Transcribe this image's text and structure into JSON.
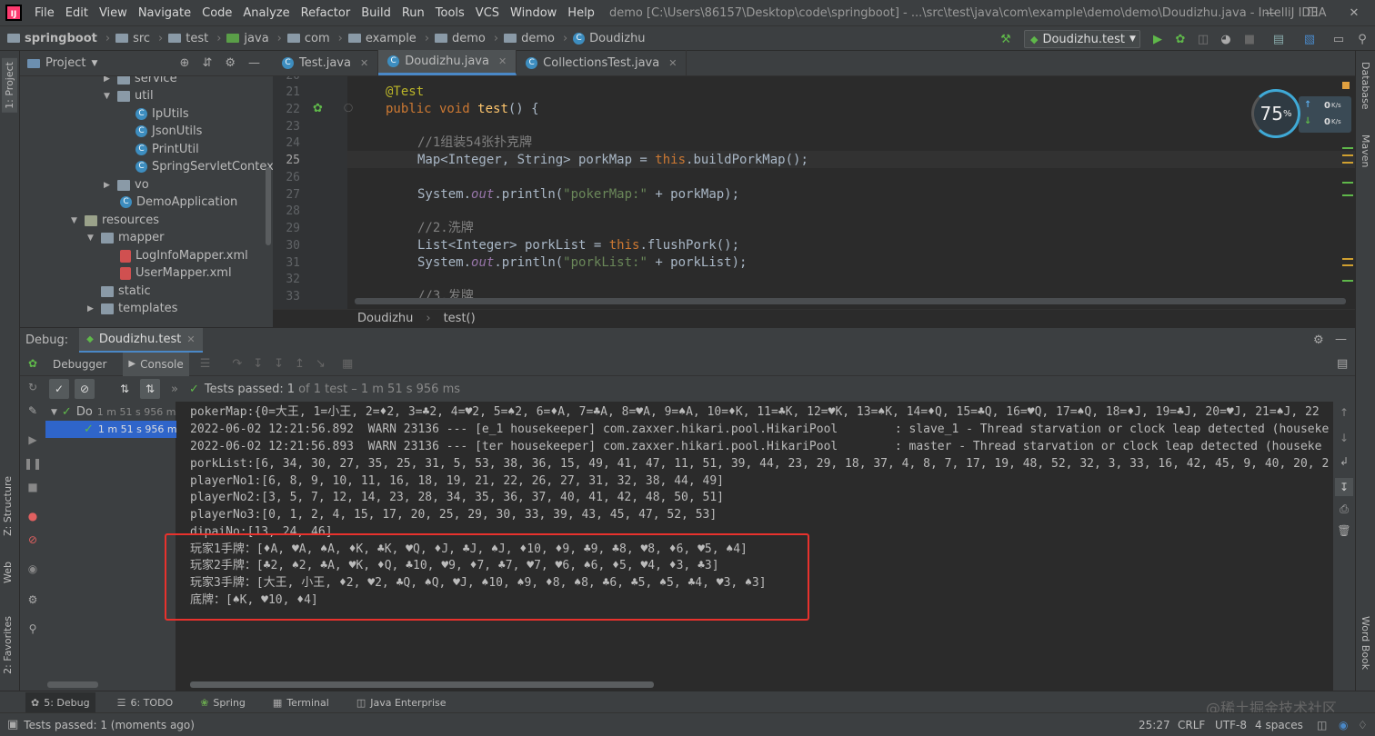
{
  "menubar": {
    "items": [
      "File",
      "Edit",
      "View",
      "Navigate",
      "Code",
      "Analyze",
      "Refactor",
      "Build",
      "Run",
      "Tools",
      "VCS",
      "Window",
      "Help"
    ],
    "window_title": "demo [C:\\Users\\86157\\Desktop\\code\\springboot] - ...\\src\\test\\java\\com\\example\\demo\\demo\\Doudizhu.java - IntelliJ IDEA"
  },
  "navbar": {
    "breadcrumbs": [
      "springboot",
      "src",
      "test",
      "java",
      "com",
      "example",
      "demo",
      "demo",
      "Doudizhu"
    ],
    "run_config": "Doudizhu.test"
  },
  "left_strip": {
    "project": "1: Project",
    "structure": "Z: Structure",
    "web": "Web",
    "favorites": "2: Favorites"
  },
  "right_strip": {
    "database": "Database",
    "maven": "Maven",
    "wordbook": "Word Book"
  },
  "project": {
    "title": "Project",
    "tree": [
      {
        "label": "service",
        "type": "folder"
      },
      {
        "label": "util",
        "type": "folder"
      },
      {
        "label": "IpUtils",
        "type": "class"
      },
      {
        "label": "JsonUtils",
        "type": "class"
      },
      {
        "label": "PrintUtil",
        "type": "class"
      },
      {
        "label": "SpringServletContextUt",
        "type": "class"
      },
      {
        "label": "vo",
        "type": "folder"
      },
      {
        "label": "DemoApplication",
        "type": "class"
      },
      {
        "label": "resources",
        "type": "folder"
      },
      {
        "label": "mapper",
        "type": "folder"
      },
      {
        "label": "LogInfoMapper.xml",
        "type": "xml"
      },
      {
        "label": "UserMapper.xml",
        "type": "xml"
      },
      {
        "label": "static",
        "type": "folder"
      },
      {
        "label": "templates",
        "type": "folder"
      }
    ]
  },
  "tabs": [
    {
      "label": "Test.java",
      "active": false
    },
    {
      "label": "Doudizhu.java",
      "active": true
    },
    {
      "label": "CollectionsTest.java",
      "active": false
    }
  ],
  "editor": {
    "line_numbers": [
      "20",
      "21",
      "22",
      "23",
      "24",
      "25",
      "26",
      "27",
      "28",
      "29",
      "30",
      "31",
      "32",
      "33"
    ],
    "lines": {
      "l21": "@Test",
      "l22a": "public void ",
      "l22b": "test",
      "l22c": "() {",
      "l24": "//1组装54张扑克牌",
      "l25a": "Map<Integer, String> porkMap = ",
      "l25b": "this",
      ".l25c": "",
      "l25c": ".buildPorkMap();",
      "l27a": "System.",
      "l27b": "out",
      "l27c": ".println(",
      "l27d": "\"pokerMap:\"",
      "l27e": " + porkMap);",
      "l29": "//2.洗牌",
      "l30a": "List<Integer> porkList = ",
      "l30b": "this",
      "l30c": ".flushPork();",
      "l31a": "System.",
      "l31b": "out",
      "l31c": ".println(",
      "l31d": "\"porkList:\"",
      "l31e": " + porkList);",
      "l33": "//3.发牌"
    },
    "breadcrumb": [
      "Doudizhu",
      "test()"
    ]
  },
  "perf": {
    "percent": "75",
    "unit": "%",
    "up": "0",
    "down": "0",
    "speed_unit": "K/s"
  },
  "debug": {
    "label": "Debug:",
    "tab": "Doudizhu.test",
    "debugger": "Debugger",
    "console": "Console",
    "test_status": "Tests passed:",
    "test_count": "1",
    "test_detail": "of 1 test – 1 m 51 s 956 ms",
    "tree_root": "Do",
    "tree_root_time": "1 m 51 s 956 ms",
    "tree_child_time": "1 m 51 s 956 ms"
  },
  "console": {
    "lines": [
      "pokerMap:{0=大王, 1=小王, 2=♦2, 3=♣2, 4=♥2, 5=♠2, 6=♦A, 7=♣A, 8=♥A, 9=♠A, 10=♦K, 11=♣K, 12=♥K, 13=♠K, 14=♦Q, 15=♣Q, 16=♥Q, 17=♠Q, 18=♦J, 19=♣J, 20=♥J, 21=♠J, 22",
      "2022-06-02 12:21:56.892  WARN 23136 --- [e_1 housekeeper] com.zaxxer.hikari.pool.HikariPool        : slave_1 - Thread starvation or clock leap detected (houseke",
      "2022-06-02 12:21:56.893  WARN 23136 --- [ter housekeeper] com.zaxxer.hikari.pool.HikariPool        : master - Thread starvation or clock leap detected (houseke",
      "porkList:[6, 34, 30, 27, 35, 25, 31, 5, 53, 38, 36, 15, 49, 41, 47, 11, 51, 39, 44, 23, 29, 18, 37, 4, 8, 7, 17, 19, 48, 52, 32, 3, 33, 16, 42, 45, 9, 40, 20, 2",
      "playerNo1:[6, 8, 9, 10, 11, 16, 18, 19, 21, 22, 26, 27, 31, 32, 38, 44, 49]",
      "playerNo2:[3, 5, 7, 12, 14, 23, 28, 34, 35, 36, 37, 40, 41, 42, 48, 50, 51]",
      "playerNo3:[0, 1, 2, 4, 15, 17, 20, 25, 29, 30, 33, 39, 43, 45, 47, 52, 53]",
      "dipaiNo:[13, 24, 46]",
      "玩家1手牌：[♦A, ♥A, ♠A, ♦K, ♣K, ♥Q, ♦J, ♣J, ♠J, ♦10, ♦9, ♣9, ♣8, ♥8, ♦6, ♥5, ♠4]",
      "玩家2手牌：[♣2, ♠2, ♣A, ♥K, ♦Q, ♣10, ♥9, ♦7, ♣7, ♥7, ♥6, ♠6, ♦5, ♥4, ♦3, ♣3]",
      "玩家3手牌：[大王, 小王, ♦2, ♥2, ♣Q, ♠Q, ♥J, ♠10, ♠9, ♦8, ♠8, ♣6, ♣5, ♠5, ♣4, ♥3, ♠3]",
      "底牌：[♠K, ♥10, ♦4]"
    ]
  },
  "bottom_tabs": [
    "5: Debug",
    "6: TODO",
    "Spring",
    "Terminal",
    "Java Enterprise"
  ],
  "status": {
    "message": "Tests passed: 1 (moments ago)",
    "position": "25:27",
    "line_sep": "CRLF",
    "encoding": "UTF-8",
    "indent": "4 spaces",
    "watermark": "@稀土掘金技术社区"
  },
  "colors": {
    "accent": "#4a88c7",
    "highlight_box": "#e8322d",
    "pass": "#5fb84a"
  }
}
